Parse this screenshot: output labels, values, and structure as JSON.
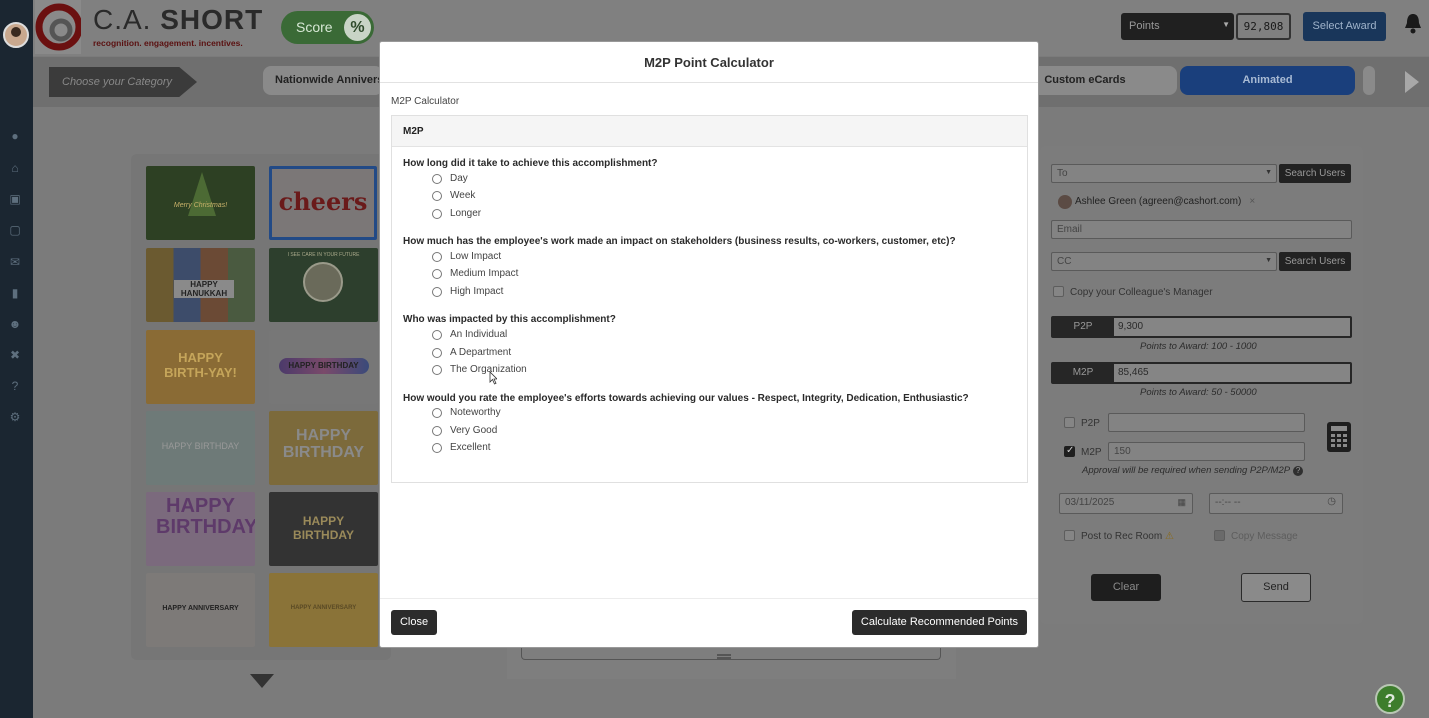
{
  "brand": {
    "name_plain": "C.A. ",
    "name_bold": "SHORT",
    "tagline": "recognition. engagement. incentives.",
    "score_label": "Score",
    "score_symbol": "%"
  },
  "header": {
    "points_label": "Points",
    "points_value": "92,808",
    "select_award": "Select Award"
  },
  "categories": {
    "choose_label": "Choose your Category",
    "items": [
      "Nationwide Annivers...",
      "Custom eCards",
      "Animated"
    ],
    "active": "Animated"
  },
  "gallery": {
    "cards": [
      {
        "text": "Merry Christmas!",
        "bg": "#2d4023"
      },
      {
        "text": "cheers",
        "bg": "#7b7777"
      },
      {
        "text": "HAPPY HANUKKAH",
        "bg": "#5a4f33"
      },
      {
        "text": "I SEE CARE IN YOUR FUTURE",
        "bg": "#2d3f2d"
      },
      {
        "text": "HAPPY BIRTH-YAY!",
        "bg": "#8a6b35"
      },
      {
        "text": "HAPPY BIRTHDAY",
        "bg": "#777"
      },
      {
        "text": "HAPPY BIRTHDAY",
        "bg": "#6e7a78"
      },
      {
        "text": "HAPPY BIRTHDAY",
        "bg": "#7c6a3b"
      },
      {
        "text": "HAPPY BIRTHDAY",
        "bg": "#7b6a7d"
      },
      {
        "text": "HAPPY BIRTHDAY",
        "bg": "#333"
      },
      {
        "text": "HAPPY ANNIVERSARY",
        "bg": "#7d7a78"
      },
      {
        "text": "HAPPY ANNIVERSARY",
        "bg": "#8a7338"
      }
    ]
  },
  "form": {
    "to_placeholder": "To",
    "search_users": "Search Users",
    "recipient_chip": "Ashlee Green (agreen@cashort.com)",
    "chip_remove": "×",
    "email_placeholder": "Email",
    "cc_placeholder": "CC",
    "copy_manager": "Copy your Colleague's Manager",
    "p2p_label": "P2P",
    "p2p_balance": "9,300",
    "p2p_range": "Points to Award: 100 - 1000",
    "m2p_label": "M2P",
    "m2p_balance": "85,465",
    "m2p_range": "Points to Award: 50 - 50000",
    "p2p_amount": "",
    "m2p_amount": "150",
    "approval_note": "Approval will be required when sending P2P/M2P",
    "help_glyph": "?",
    "date_value": "03/11/2025",
    "time_value": "--:-- --",
    "post_rec_room": "Post to Rec Room",
    "copy_message": "Copy Message",
    "clear": "Clear",
    "send": "Send"
  },
  "modal": {
    "title": "M2P Point Calculator",
    "subtitle": "M2P Calculator",
    "panel_heading": "M2P",
    "questions": [
      {
        "text": "How long did it take to achieve this accomplishment?",
        "options": [
          "Day",
          "Week",
          "Longer"
        ]
      },
      {
        "text": "How much has the employee's work made an impact on stakeholders (business results, co-workers, customer, etc)?",
        "options": [
          "Low Impact",
          "Medium Impact",
          "High Impact"
        ]
      },
      {
        "text": "Who was impacted by this accomplishment?",
        "options": [
          "An Individual",
          "A Department",
          "The Organization"
        ]
      },
      {
        "text": "How would you rate the employee's efforts towards achieving our values - Respect, Integrity, Dedication, Enthusiastic?",
        "options": [
          "Noteworthy",
          "Very Good",
          "Excellent"
        ]
      }
    ],
    "close": "Close",
    "calculate": "Calculate Recommended Points"
  },
  "help_fab": "?",
  "colors": {
    "overlay_gray": "#7b7b7b",
    "rail": "#1b2631",
    "accent_blue": "#1a3f7c",
    "score_green": "#3a6a36"
  }
}
